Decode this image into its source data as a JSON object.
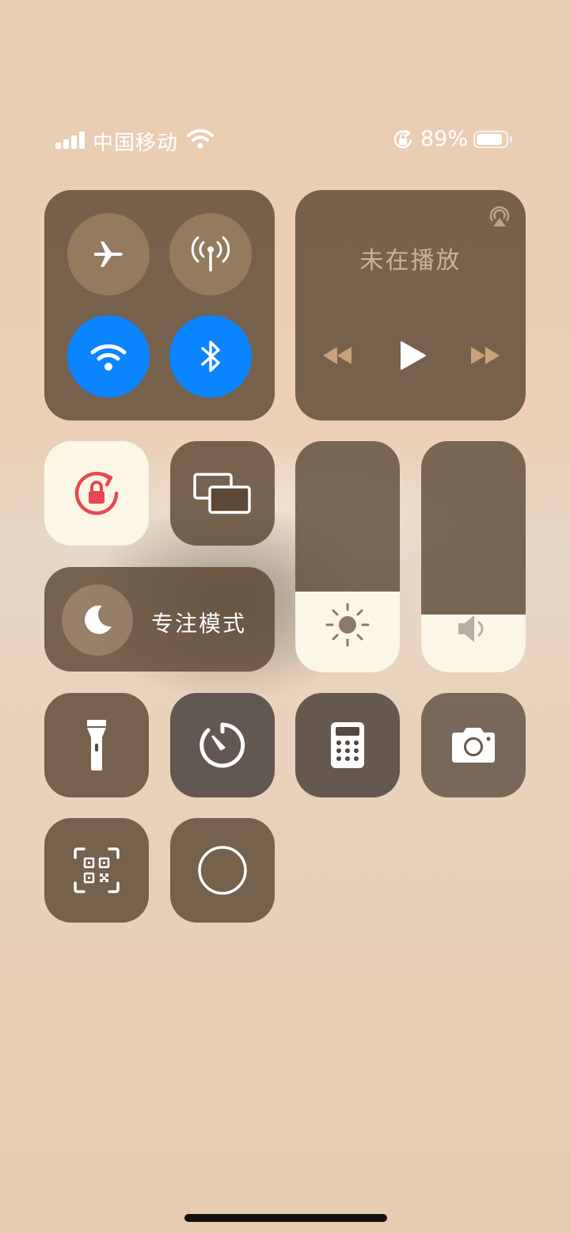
{
  "status_bar": {
    "carrier": "中国移动",
    "battery_percent": "89%",
    "battery_level": 0.89,
    "signal_icon": "cellular-signal-icon",
    "wifi_icon": "wifi-icon",
    "orientation_icon": "orientation-lock-icon"
  },
  "connectivity": {
    "airplane_mode": false,
    "cellular_data": false,
    "wifi": true,
    "bluetooth": true
  },
  "media": {
    "status": "未在播放",
    "airplay_icon": "airplay-icon",
    "controls": [
      "rewind-icon",
      "play-icon",
      "fast-forward-icon"
    ]
  },
  "orientation_lock": {
    "enabled": true
  },
  "focus": {
    "label": "专注模式",
    "icon": "moon-icon"
  },
  "brightness": {
    "level": 0.35
  },
  "volume": {
    "level": 0.25
  },
  "controls": [
    "flashlight-icon",
    "timer-icon",
    "calculator-icon",
    "camera-icon",
    "qr-scanner-icon",
    "screen-record-icon"
  ],
  "colors": {
    "active_blue": "#0a84ff",
    "lock_red": "#e8474f",
    "tile": "#5c4834",
    "slider_fill": "#fbf6e6"
  }
}
